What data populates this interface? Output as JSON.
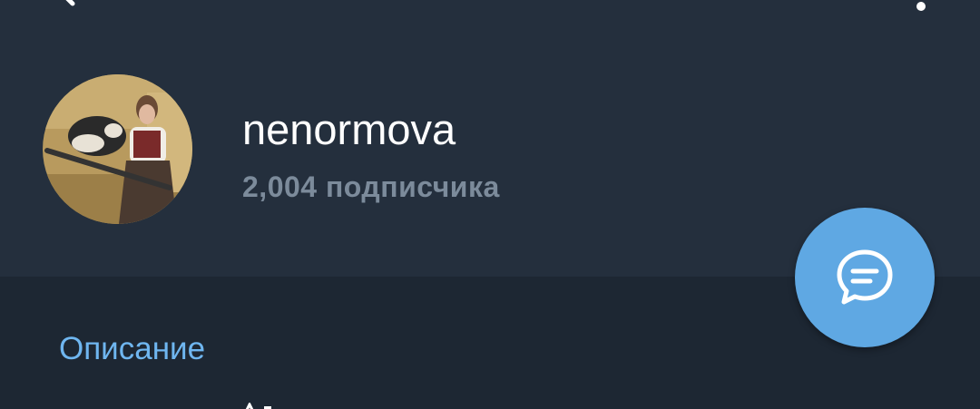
{
  "toolbar": {
    "back_icon": "back-arrow-icon",
    "menu_icon": "more-vertical-icon"
  },
  "channel": {
    "name": "nenormova",
    "subscribers": "2,004 подписчика",
    "avatar_icon": "channel-avatar"
  },
  "fab": {
    "icon": "message-icon",
    "color": "#5fa8e3"
  },
  "info": {
    "section_title": "Описание"
  },
  "colors": {
    "header_bg": "#242f3d",
    "page_bg": "#1d2733",
    "accent": "#6fb6f0",
    "muted_text": "#7c8b9b"
  }
}
